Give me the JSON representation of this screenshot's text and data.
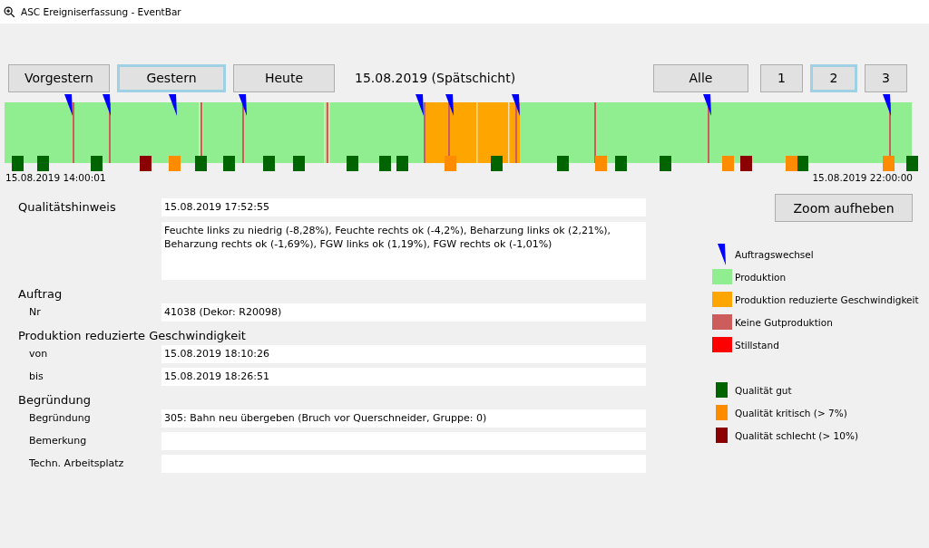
{
  "window": {
    "title": "ASC Ereigniserfassung - EventBar"
  },
  "day_buttons": [
    {
      "label": "Vorgestern",
      "selected": false
    },
    {
      "label": "Gestern",
      "selected": true
    },
    {
      "label": "Heute",
      "selected": false
    }
  ],
  "shift_label": "15.08.2019 (Spätschicht)",
  "page_buttons": [
    {
      "label": "Alle",
      "selected": false
    },
    {
      "label": "1",
      "selected": false
    },
    {
      "label": "2",
      "selected": true
    },
    {
      "label": "3",
      "selected": false
    }
  ],
  "timeline": {
    "start": "15.08.2019 14:00:01",
    "end": "15.08.2019 22:00:00"
  },
  "zoom_button": "Zoom aufheben",
  "sections": [
    {
      "heading": "Qualitätshinweis",
      "fields": [
        {
          "value": "15.08.2019 17:52:55",
          "kind": "line"
        },
        {
          "value": "Feuchte links zu niedrig (-8,28%), Feuchte rechts ok (-4,2%), Beharzung links ok (2,21%), Beharzung rechts ok (-1,69%), FGW links ok (1,19%), FGW rechts ok (-1,01%)",
          "kind": "area"
        }
      ]
    },
    {
      "heading": "Auftrag",
      "fields": [
        {
          "label": "Nr",
          "value": "41038 (Dekor: R20098)",
          "kind": "line"
        }
      ]
    },
    {
      "heading": "Produktion reduzierte Geschwindigkeit",
      "fields": [
        {
          "label": "von",
          "value": "15.08.2019 18:10:26",
          "kind": "line"
        },
        {
          "label": "bis",
          "value": "15.08.2019 18:26:51",
          "kind": "line"
        }
      ]
    },
    {
      "heading": "Begründung",
      "fields": [
        {
          "label": "Begründung",
          "value": "305: Bahn neu übergeben (Bruch vor Querschneider, Gruppe: 0)",
          "kind": "line"
        },
        {
          "label": "Bemerkung",
          "kind": "line"
        },
        {
          "label": "Techn. Arbeitsplatz",
          "kind": "line"
        }
      ]
    }
  ],
  "legend": [
    {
      "label": "Auftragswechsel",
      "kind": "flag",
      "color": "#0000ff"
    },
    {
      "label": "Produktion",
      "kind": "swatch",
      "color": "#90ee90"
    },
    {
      "label": "Produktion reduzierte Geschwindigkeit",
      "kind": "swatch",
      "color": "#ffa500"
    },
    {
      "label": "Keine Gutproduktion",
      "kind": "swatch",
      "color": "#cd5c5c"
    },
    {
      "label": "Stillstand",
      "kind": "swatch",
      "color": "#ff0000"
    },
    {
      "label": "Qualität gut",
      "kind": "marker",
      "color": "#006400"
    },
    {
      "label": "Qualität kritisch (> 7%)",
      "kind": "marker",
      "color": "#ff8c00"
    },
    {
      "label": "Qualität schlecht (> 10%)",
      "kind": "marker",
      "color": "#8b0000"
    }
  ]
}
